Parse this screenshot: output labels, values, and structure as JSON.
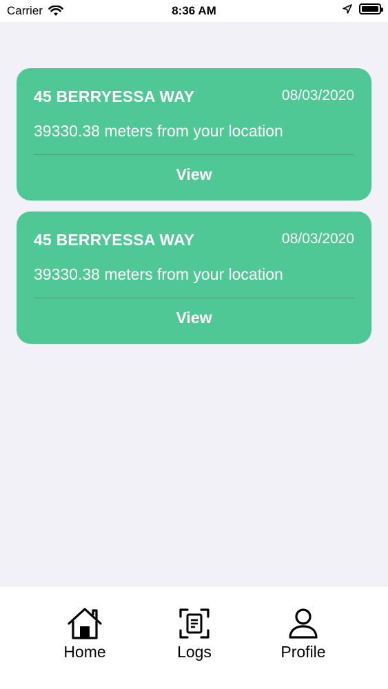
{
  "status_bar": {
    "carrier": "Carrier",
    "time": "8:36 AM"
  },
  "cards": [
    {
      "address": "45 BERRYESSA WAY",
      "date": "08/03/2020",
      "distance": "39330.38 meters from your location",
      "action_label": "View"
    },
    {
      "address": "45 BERRYESSA WAY",
      "date": "08/03/2020",
      "distance": "39330.38 meters from your location",
      "action_label": "View"
    }
  ],
  "tab_bar": {
    "home_label": "Home",
    "logs_label": "Logs",
    "profile_label": "Profile"
  },
  "colors": {
    "card_background": "#50c896",
    "screen_background": "#f2f1f7",
    "text_on_card": "#ffffff"
  },
  "icons": {
    "wifi": "wifi-icon",
    "location": "location-arrow-icon",
    "battery": "battery-icon",
    "home": "home-icon",
    "logs": "logs-icon",
    "profile": "profile-icon"
  }
}
